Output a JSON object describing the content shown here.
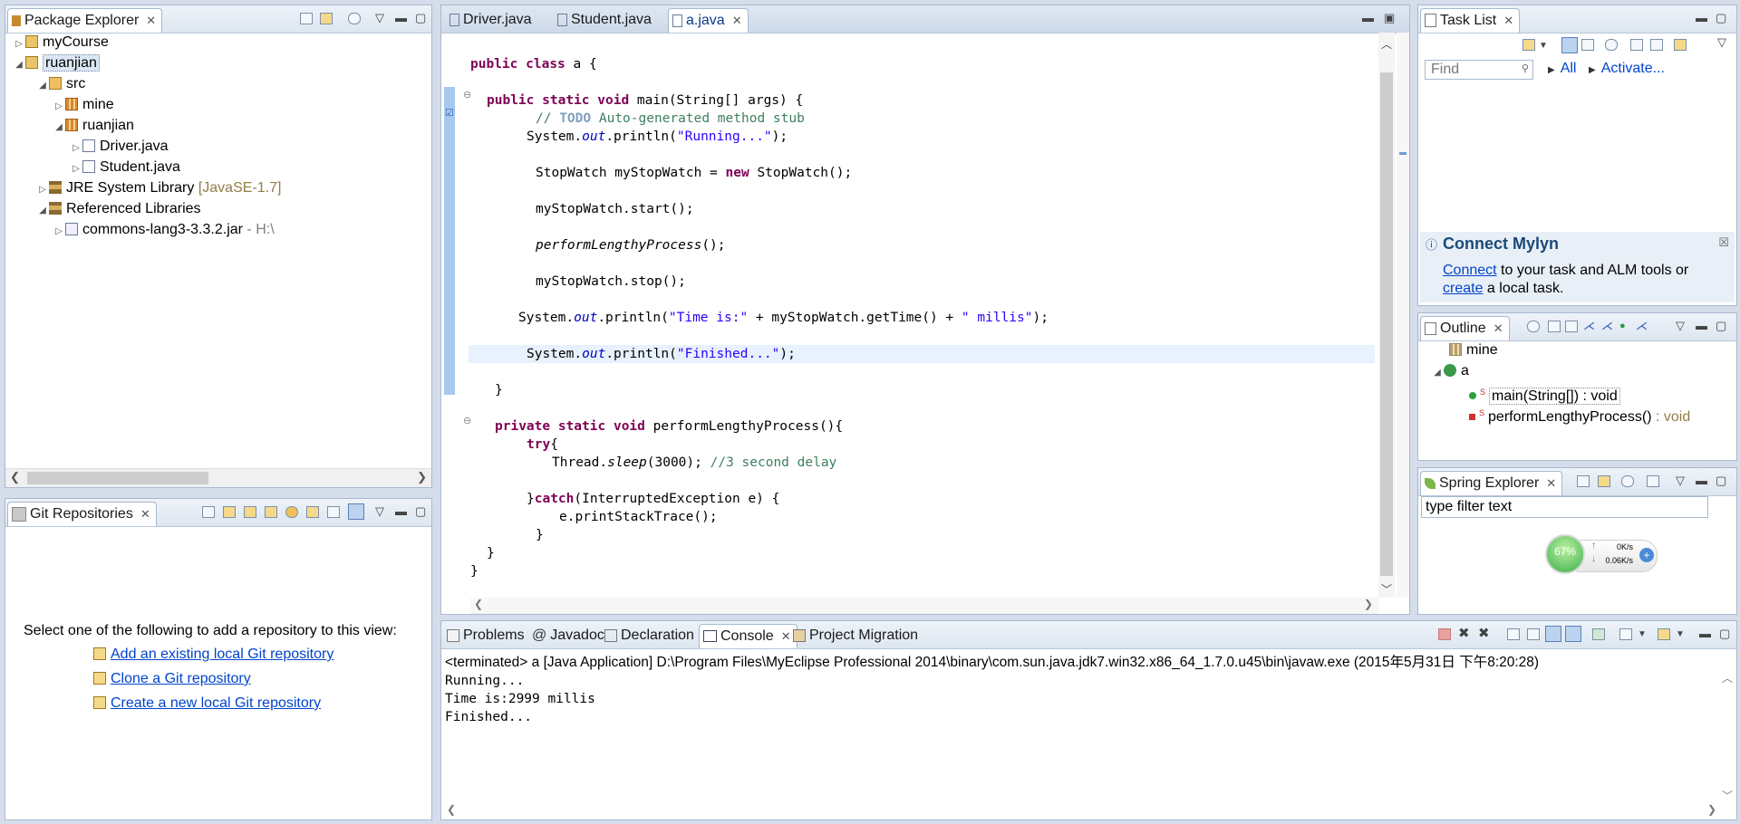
{
  "package_explorer": {
    "tab": "Package Explorer",
    "tree": [
      {
        "label": "myCourse"
      },
      {
        "label": "ruanjian"
      },
      {
        "label": "src"
      },
      {
        "label": "mine"
      },
      {
        "label": "ruanjian"
      },
      {
        "label": "Driver.java"
      },
      {
        "label": "Student.java"
      },
      {
        "label": "JRE System Library",
        "suffix": "[JavaSE-1.7]"
      },
      {
        "label": "Referenced Libraries"
      },
      {
        "label": "commons-lang3-3.3.2.jar",
        "suffix": "- H:\\"
      }
    ]
  },
  "git": {
    "tab": "Git Repositories",
    "prompt": "Select one of the following to add a repository to this view:",
    "links": [
      "Add an existing local Git repository",
      "Clone a Git repository",
      "Create a new local Git repository"
    ]
  },
  "editor": {
    "tabs": [
      "Driver.java",
      "Student.java",
      "a.java"
    ],
    "active_tab": "a.java"
  },
  "tasklist": {
    "tab": "Task List",
    "find_placeholder": "Find",
    "all": "All",
    "activate": "Activate...",
    "mylyn_title": "Connect Mylyn",
    "mylyn_connect": "Connect",
    "mylyn_text1": " to your task and ALM tools or",
    "mylyn_create": "create",
    "mylyn_text2": " a local task."
  },
  "outline": {
    "tab": "Outline",
    "items": [
      "mine",
      "a",
      "main(String[]) : void",
      "performLengthyProcess()"
    ],
    "item4_type": " : void"
  },
  "spring": {
    "tab": "Spring Explorer",
    "filter_value": "type filter text",
    "widget_percent": "67%",
    "widget_up": "0K/s",
    "widget_down": "0.06K/s"
  },
  "bottom": {
    "tabs": [
      "Problems",
      "Javadoc",
      "Declaration",
      "Console",
      "Project Migration"
    ],
    "active_tab": "Console",
    "header": "<terminated> a [Java Application] D:\\Program Files\\MyEclipse Professional 2014\\binary\\com.sun.java.jdk7.win32.x86_64_1.7.0.u45\\bin\\javaw.exe (2015年5月31日 下午8:20:28)",
    "lines": [
      "Running...",
      "Time is:2999 millis",
      "Finished..."
    ]
  },
  "colors": {
    "accent": "#0044cc",
    "keyword": "#7f0055",
    "string": "#2a00ff",
    "comment": "#3f7f5f"
  }
}
